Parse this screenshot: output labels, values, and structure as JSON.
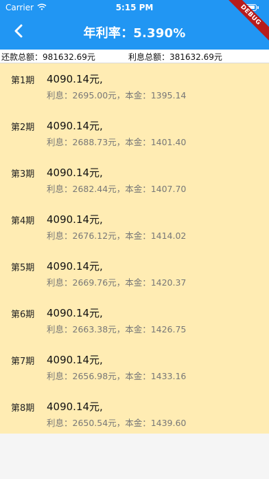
{
  "status_bar": {
    "carrier": "Carrier",
    "time": "5:15 PM",
    "wifi_icon": "wifi-icon",
    "battery_icon": "battery-icon"
  },
  "app_bar": {
    "title": "年利率：5.390%",
    "back_icon": "chevron-left-icon",
    "debug_badge": "DEBUG",
    "background_color": "#2196f3",
    "debug_color": "#b71c1c"
  },
  "summary": {
    "repayment_total": "还款总额：981632.69元",
    "interest_total": "利息总额：381632.69元"
  },
  "list": {
    "background_color": "#ffecb3",
    "items": [
      {
        "period": "第1期",
        "amount": "4090.14元,",
        "detail": "利息：2695.00元，本金：1395.14"
      },
      {
        "period": "第2期",
        "amount": "4090.14元,",
        "detail": "利息：2688.73元，本金：1401.40"
      },
      {
        "period": "第3期",
        "amount": "4090.14元,",
        "detail": "利息：2682.44元，本金：1407.70"
      },
      {
        "period": "第4期",
        "amount": "4090.14元,",
        "detail": "利息：2676.12元，本金：1414.02"
      },
      {
        "period": "第5期",
        "amount": "4090.14元,",
        "detail": "利息：2669.76元，本金：1420.37"
      },
      {
        "period": "第6期",
        "amount": "4090.14元,",
        "detail": "利息：2663.38元，本金：1426.75"
      },
      {
        "period": "第7期",
        "amount": "4090.14元,",
        "detail": "利息：2656.98元，本金：1433.16"
      },
      {
        "period": "第8期",
        "amount": "4090.14元,",
        "detail": "利息：2650.54元，本金：1439.60"
      }
    ]
  }
}
